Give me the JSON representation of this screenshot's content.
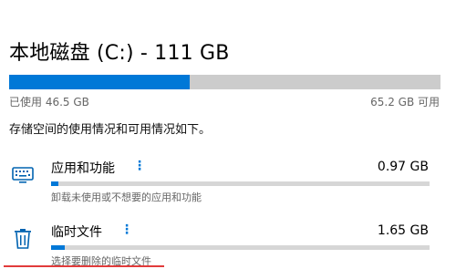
{
  "drive": {
    "title": "本地磁盘 (C:) - 111 GB",
    "used_label": "已使用 46.5 GB",
    "free_label": "65.2 GB 可用",
    "usage_fraction": 0.419,
    "accent_color": "#0078d7"
  },
  "summary": "存储空间的使用情况和可用情况如下。",
  "categories": [
    {
      "icon": "keyboard-icon",
      "name": "应用和功能",
      "size": "0.97 GB",
      "subtitle": "卸载未使用或不想要的应用和功能",
      "usage_fraction": 0.02
    },
    {
      "icon": "trash-icon",
      "name": "临时文件",
      "size": "1.65 GB",
      "subtitle": "选择要删除的临时文件",
      "usage_fraction": 0.035
    }
  ],
  "annotation_color": "#e23b3b"
}
